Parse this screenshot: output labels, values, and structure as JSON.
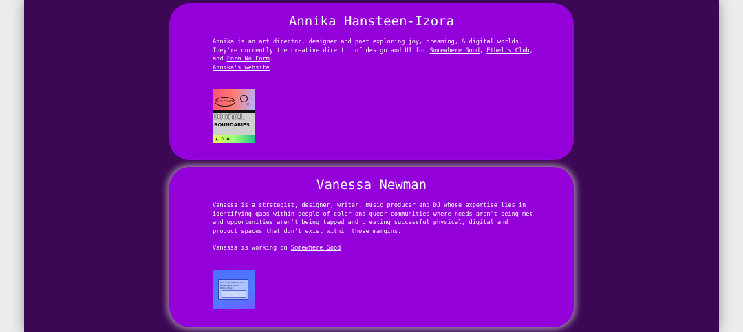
{
  "profiles": [
    {
      "name": "Annika Hansteen-Izora",
      "bio_pre": "Annika is an art director, designer and poet exploring joy, dreaming, & digital worlds. They're currently the creative director of design and UI for ",
      "links": [
        "Somewhere Good",
        "Ethel's Club",
        "Form No Form"
      ],
      "sep1": ", ",
      "sep2": ", and ",
      "bio_end": ".",
      "website_link": "Annika's website",
      "thumbnail": {
        "oval_text": "NOTES ON",
        "title": "DIGITAL",
        "subtitle": "BOUNDARIES",
        "icons": [
          "smiley-icon",
          "asterisk-icon",
          "triangle-icon",
          "house-icon"
        ]
      }
    },
    {
      "name": "Vanessa Newman",
      "bio": "Vanessa is a strategist, designer, writer, music producer and DJ whose expertise lies in identifying gaps within people of color and queer communities where needs aren't being met and opportunities aren't being tapped and creating successful physical, digital and product spaces that don't exist within those margins.",
      "working_pre": "Vanessa is working on ",
      "working_link": "Somewhere Good",
      "thumbnail": {
        "caption": "How To Host Better Mics & Getting a Sound Within Music"
      }
    }
  ],
  "colors": {
    "page_background": "#3c0853",
    "card_background": "#9400d9",
    "outer_background": "#ececec",
    "text": "#ffffff"
  }
}
